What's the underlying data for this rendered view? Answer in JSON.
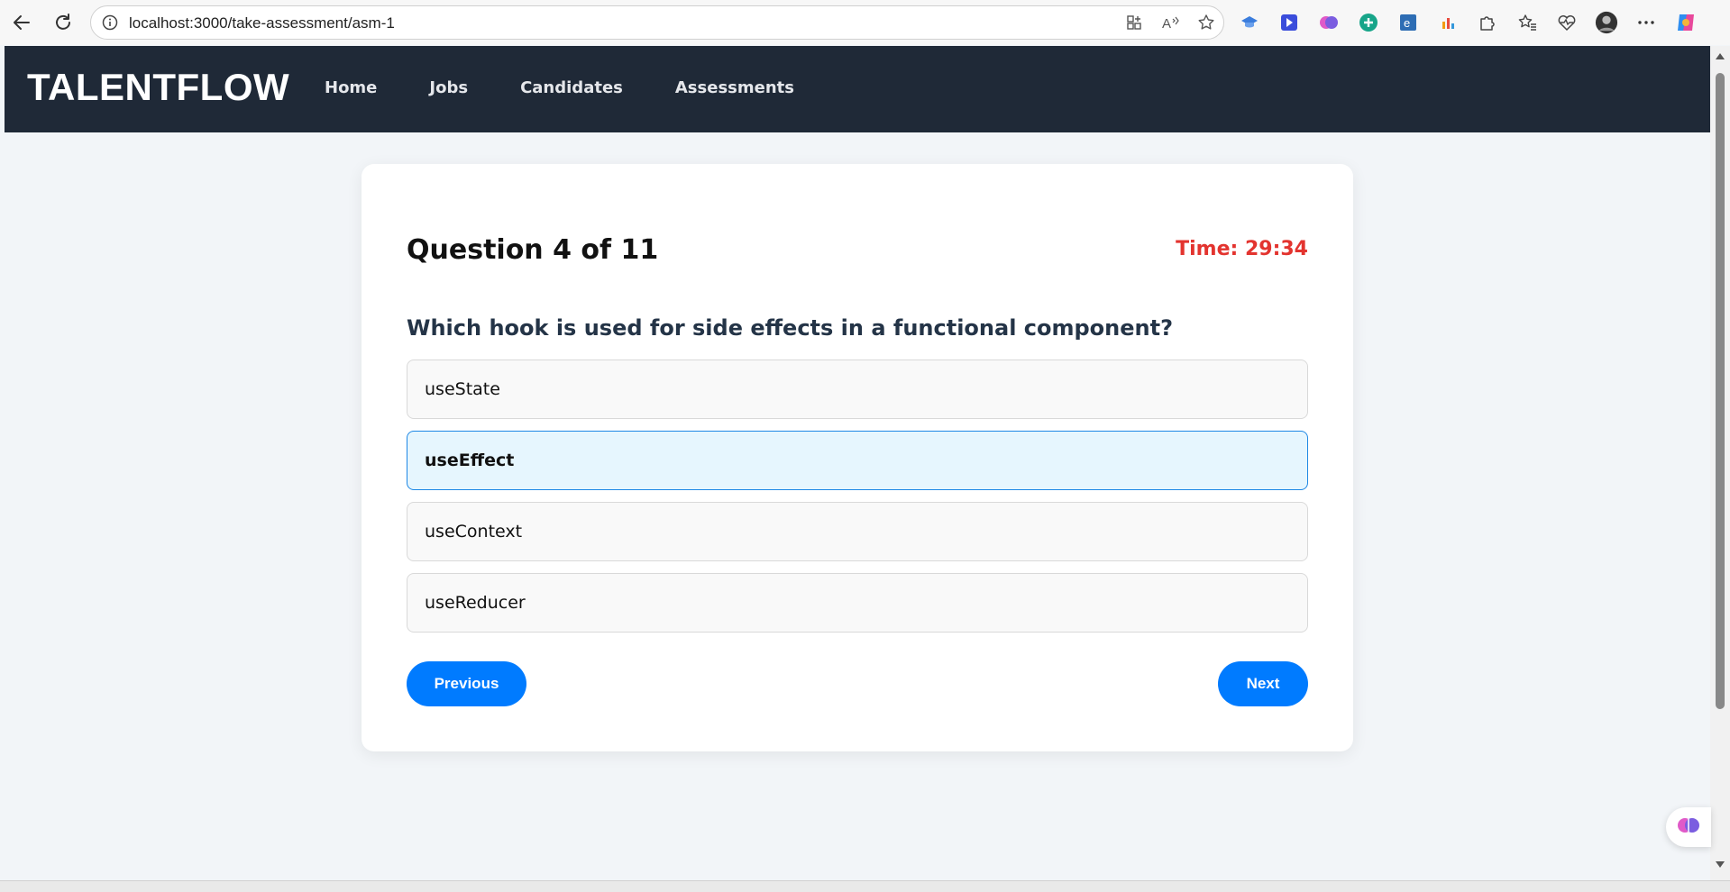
{
  "browser": {
    "url": "localhost:3000/take-assessment/asm-1"
  },
  "header": {
    "brand": "TALENTFLOW",
    "nav": [
      "Home",
      "Jobs",
      "Candidates",
      "Assessments"
    ]
  },
  "assessment": {
    "counter": "Question 4 of 11",
    "timer": "Time: 29:34",
    "question": "Which hook is used for side effects in a functional component?",
    "options": [
      "useState",
      "useEffect",
      "useContext",
      "useReducer"
    ],
    "selected_option": "useEffect",
    "previous_label": "Previous",
    "next_label": "Next"
  },
  "colors": {
    "header_bg": "#1f2937",
    "accent": "#007bff",
    "timer": "#e3342f",
    "selected_bg": "#e6f6fe"
  }
}
